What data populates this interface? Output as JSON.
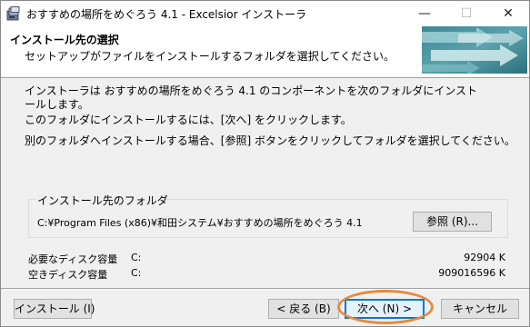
{
  "window": {
    "title": "おすすめの場所をめぐろう 4.1 - Excelsior インストーラ",
    "minimize_glyph": "—",
    "maximize_glyph": "☐",
    "close_glyph": "✕"
  },
  "header": {
    "title": "インストール先の選択",
    "subtitle": "セットアップがファイルをインストールするフォルダを選択してください。"
  },
  "body": {
    "line1": "インストーラは おすすめの場所をめぐろう 4.1 のコンポーネントを次のフォルダにインストールします。",
    "line2": "このフォルダにインストールするには、[次へ] をクリックします。",
    "line3": "別のフォルダへインストールする場合、[参照] ボタンをクリックしてフォルダを選択してください。"
  },
  "folder_group": {
    "legend": "インストール先のフォルダ",
    "path": "C:¥Program Files (x86)¥和田システム¥おすすめの場所をめぐろう 4.1",
    "browse_label": "参照 (R)..."
  },
  "disk": {
    "required_label": "必要なディスク容量",
    "required_drive": "C:",
    "required_value": "92904 K",
    "free_label": "空きディスク容量",
    "free_drive": "C:",
    "free_value": "909016596 K"
  },
  "buttons": {
    "install": "インストール (I)",
    "back": "< 戻る (B)",
    "next": "次へ (N) >",
    "cancel": "キャンセル"
  },
  "colors": {
    "accent": "#0078d7",
    "highlight_ring": "#e8893a"
  }
}
